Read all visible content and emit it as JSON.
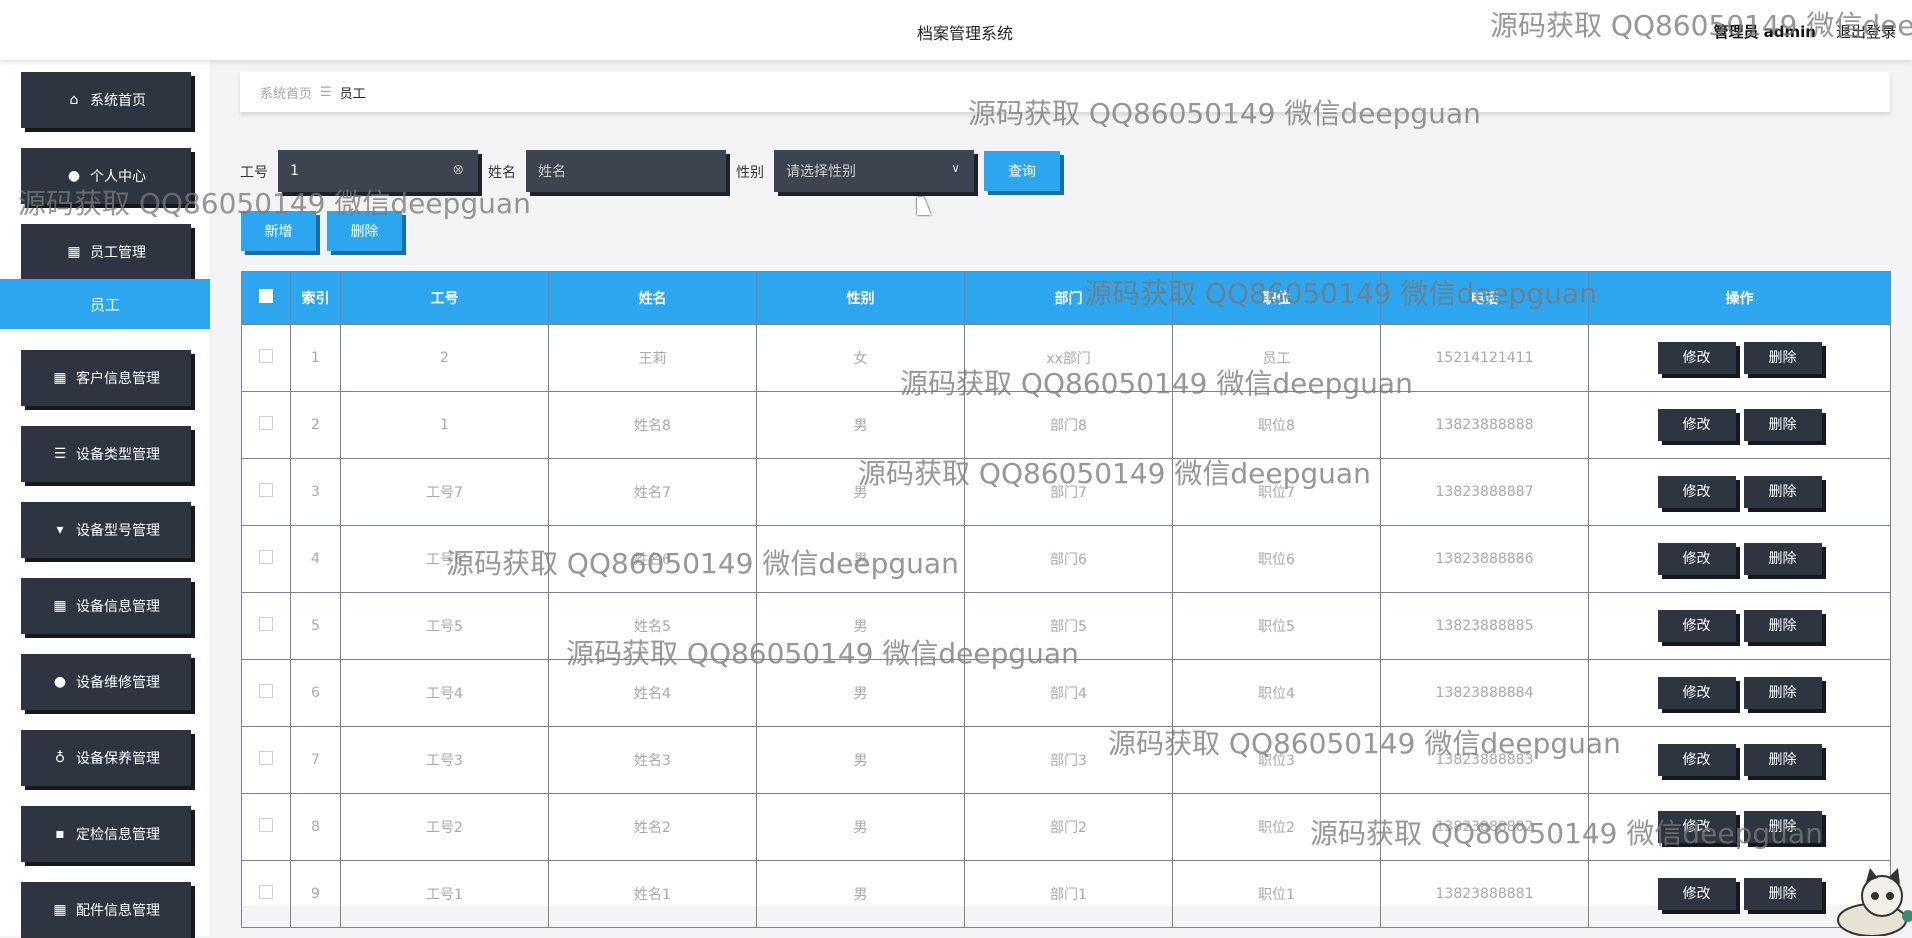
{
  "header": {
    "title": "档案管理系统",
    "user_label": "管理员 admin",
    "logout_label": "退出登录"
  },
  "sidebar": {
    "items": [
      {
        "label": "系统首页",
        "icon": "home-icon"
      },
      {
        "label": "个人中心",
        "icon": "user-icon"
      },
      {
        "label": "员工管理",
        "icon": "grid-icon"
      },
      {
        "label": "客户信息管理",
        "icon": "grid-icon"
      },
      {
        "label": "设备类型管理",
        "icon": "sliders-icon"
      },
      {
        "label": "设备型号管理",
        "icon": "brush-icon"
      },
      {
        "label": "设备信息管理",
        "icon": "grid-icon"
      },
      {
        "label": "设备维修管理",
        "icon": "user-icon"
      },
      {
        "label": "设备保养管理",
        "icon": "bulb-icon"
      },
      {
        "label": "定检信息管理",
        "icon": "chat-icon"
      },
      {
        "label": "配件信息管理",
        "icon": "grid-icon"
      }
    ],
    "active_sub": "员工"
  },
  "breadcrumb": {
    "home": "系统首页",
    "current": "员工"
  },
  "search": {
    "id_label": "工号",
    "id_value": "1",
    "name_label": "姓名",
    "name_placeholder": "姓名",
    "gender_label": "性别",
    "gender_placeholder": "请选择性别",
    "query_button": "查询"
  },
  "actions": {
    "add": "新增",
    "delete": "删除"
  },
  "table": {
    "headers": [
      "索引",
      "工号",
      "姓名",
      "性别",
      "部门",
      "职位",
      "电话",
      "操作"
    ],
    "edit_label": "修改",
    "delete_label": "删除",
    "rows": [
      [
        "1",
        "2",
        "王莉",
        "女",
        "xx部门",
        "员工",
        "15214121411"
      ],
      [
        "2",
        "1",
        "姓名8",
        "男",
        "部门8",
        "职位8",
        "13823888888"
      ],
      [
        "3",
        "工号7",
        "姓名7",
        "男",
        "部门7",
        "职位7",
        "13823888887"
      ],
      [
        "4",
        "工号6",
        "姓名6",
        "男",
        "部门6",
        "职位6",
        "13823888886"
      ],
      [
        "5",
        "工号5",
        "姓名5",
        "男",
        "部门5",
        "职位5",
        "13823888885"
      ],
      [
        "6",
        "工号4",
        "姓名4",
        "男",
        "部门4",
        "职位4",
        "13823888884"
      ],
      [
        "7",
        "工号3",
        "姓名3",
        "男",
        "部门3",
        "职位3",
        "13823888883"
      ],
      [
        "8",
        "工号2",
        "姓名2",
        "男",
        "部门2",
        "职位2",
        "13823888882"
      ],
      [
        "9",
        "工号1",
        "姓名1",
        "男",
        "部门1",
        "职位1",
        "13823888881"
      ]
    ]
  },
  "watermark": "源码获取 QQ86050149 微信deepguan",
  "colors": {
    "accent": "#2ea6ef",
    "dark": "#2e3440"
  }
}
